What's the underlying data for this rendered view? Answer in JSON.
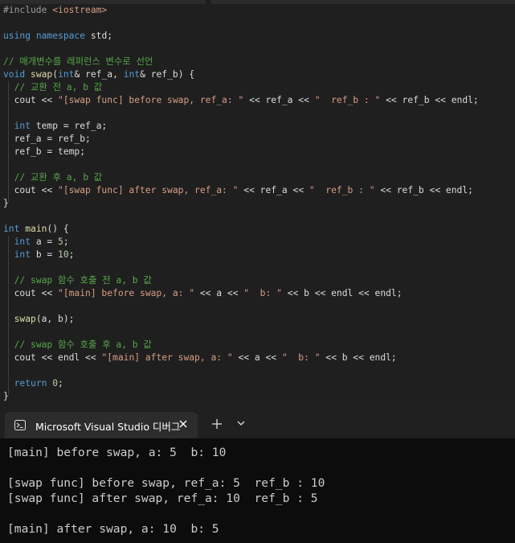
{
  "editor": {
    "code_lines": [
      "#include <iostream>",
      "",
      "using namespace std;",
      "",
      "// 매개변수를 레퍼런스 변수로 선언",
      "void swap(int& ref_a, int& ref_b) {",
      "  // 교환 전 a, b 값",
      "  cout << \"[swap func] before swap, ref_a: \" << ref_a << \"  ref_b : \" << ref_b << endl;",
      "",
      "  int temp = ref_a;",
      "  ref_a = ref_b;",
      "  ref_b = temp;",
      "",
      "  // 교환 후 a, b 값",
      "  cout << \"[swap func] after swap, ref_a: \" << ref_a << \"  ref_b : \" << ref_b << endl;",
      "}",
      "",
      "int main() {",
      "  int a = 5;",
      "  int b = 10;",
      "",
      "  // swap 함수 호출 전 a, b 값",
      "  cout << \"[main] before swap, a: \" << a << \"  b: \" << b << endl << endl;",
      "",
      "  swap(a, b);",
      "",
      "  // swap 함수 호출 후 a, b 값",
      "  cout << endl << \"[main] after swap, a: \" << a << \"  b: \" << b << endl;",
      "",
      "  return 0;",
      "}"
    ]
  },
  "terminal": {
    "tab_title": "Microsoft Visual Studio 디버그",
    "tab_icon": "terminal-icon",
    "close_icon": "close-icon",
    "new_tab_icon": "plus-icon",
    "dropdown_icon": "chevron-down-icon",
    "output_lines": [
      "[main] before swap, a: 5  b: 10",
      "",
      "[swap func] before swap, ref_a: 5  ref_b : 10",
      "[swap func] after swap, ref_a: 10  ref_b : 5",
      "",
      "[main] after swap, a: 10  b: 5"
    ]
  },
  "colors": {
    "editor_bg": "#1f1f1f",
    "keyword": "#569cd6",
    "string": "#d69d85",
    "comment": "#57a64a",
    "function": "#dcdcaa",
    "terminal_bg": "#0c0c0c"
  }
}
